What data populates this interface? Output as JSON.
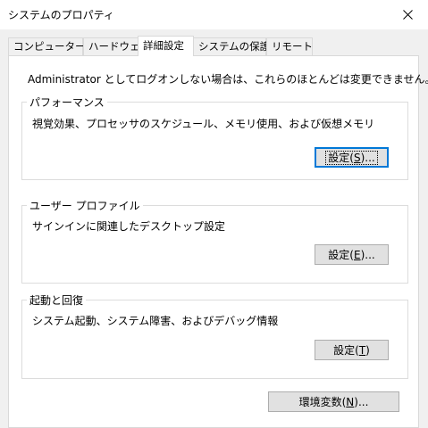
{
  "window": {
    "title": "システムのプロパティ",
    "close_icon": "close-icon"
  },
  "tabs": [
    {
      "label": "コンピューター名",
      "active": false
    },
    {
      "label": "ハードウェア",
      "active": false
    },
    {
      "label": "詳細設定",
      "active": true
    },
    {
      "label": "システムの保護",
      "active": false
    },
    {
      "label": "リモート",
      "active": false
    }
  ],
  "notice": "Administrator としてログオンしない場合は、これらのほとんどは変更できません。",
  "performance": {
    "title": "パフォーマンス",
    "description": "視覚効果、プロセッサのスケジュール、メモリ使用、および仮想メモリ",
    "button": {
      "pre": "設定(",
      "key": "S",
      "post": ")..."
    }
  },
  "user_profile": {
    "title": "ユーザー プロファイル",
    "description": "サインインに関連したデスクトップ設定",
    "button": {
      "pre": "設定(",
      "key": "E",
      "post": ")..."
    }
  },
  "startup_recovery": {
    "title": "起動と回復",
    "description": "システム起動、システム障害、およびデバッグ情報",
    "button": {
      "pre": "設定(",
      "key": "T",
      "post": ")"
    }
  },
  "env_button": {
    "pre": "環境変数(",
    "key": "N",
    "post": ")..."
  },
  "colors": {
    "focus_border": "#0078d7",
    "button_face": "#e1e1e1"
  }
}
